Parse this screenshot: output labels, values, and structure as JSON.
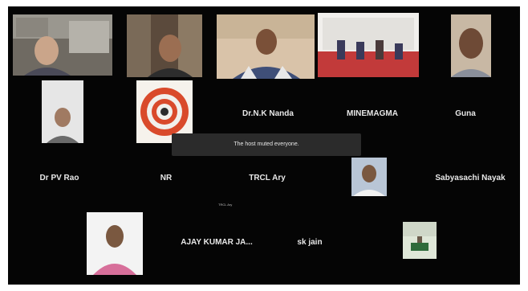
{
  "meeting": {
    "toast_message": "The host muted everyone.",
    "speaking_label": "TRCL Ary"
  },
  "participants": [
    {
      "name": "",
      "kind": "video"
    },
    {
      "name": "",
      "kind": "video"
    },
    {
      "name": "",
      "kind": "video"
    },
    {
      "name": "",
      "kind": "video"
    },
    {
      "name": "",
      "kind": "video"
    },
    {
      "name": "",
      "kind": "photo"
    },
    {
      "name": "",
      "kind": "logo"
    },
    {
      "name": "Dr.N.K Nanda",
      "kind": "name-only"
    },
    {
      "name": "MINEMAGMA",
      "kind": "name-only"
    },
    {
      "name": "Guna",
      "kind": "name-only"
    },
    {
      "name": "Dr PV Rao",
      "kind": "name-only"
    },
    {
      "name": "NR",
      "kind": "name-only"
    },
    {
      "name": "TRCL Ary",
      "kind": "name-only"
    },
    {
      "name": "",
      "kind": "photo"
    },
    {
      "name": "Sabyasachi Nayak",
      "kind": "name-only"
    },
    {
      "name": "",
      "kind": "photo"
    },
    {
      "name": "AJAY KUMAR JA...",
      "kind": "name-only"
    },
    {
      "name": "sk jain",
      "kind": "name-only"
    },
    {
      "name": "",
      "kind": "photo"
    }
  ],
  "colors": {
    "background": "#050505",
    "name_text": "#e8e8e8",
    "toast_bg": "#2b2b2b"
  }
}
